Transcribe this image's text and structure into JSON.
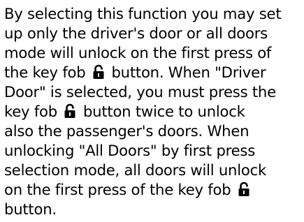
{
  "manual": {
    "lines": [
      [
        "By selecting this function you may set"
      ],
      [
        "up only the driver's door or all doors"
      ],
      [
        "mode will unlock on the first press of"
      ],
      [
        "the key fob",
        "button. When \"Driver"
      ],
      [
        "Door\" is selected, you must press the"
      ],
      [
        "key fob",
        "button twice to unlock"
      ],
      [
        "also the passenger's doors. When"
      ],
      [
        "unlocking \"All Doors\" by first press"
      ],
      [
        "selection mode, all doors will unlock"
      ],
      [
        "on the first press of the key fob",
        ""
      ],
      [
        "button."
      ]
    ],
    "icon": "unlock-padlock-icon"
  }
}
